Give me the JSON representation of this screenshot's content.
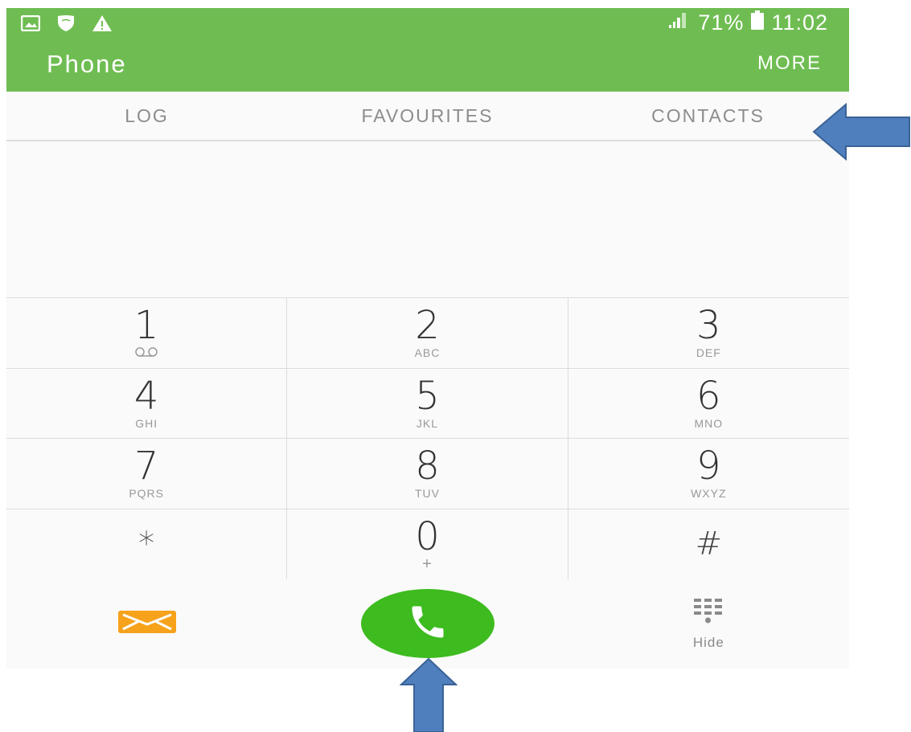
{
  "status_bar": {
    "battery": "71%",
    "time": "11:02"
  },
  "app_bar": {
    "title": "Phone",
    "more_label": "MORE"
  },
  "tabs": [
    {
      "label": "LOG"
    },
    {
      "label": "FAVOURITES"
    },
    {
      "label": "CONTACTS"
    }
  ],
  "keypad": {
    "rows": [
      [
        {
          "digit": "1",
          "letters": ""
        },
        {
          "digit": "2",
          "letters": "ABC"
        },
        {
          "digit": "3",
          "letters": "DEF"
        }
      ],
      [
        {
          "digit": "4",
          "letters": "GHI"
        },
        {
          "digit": "5",
          "letters": "JKL"
        },
        {
          "digit": "6",
          "letters": "MNO"
        }
      ],
      [
        {
          "digit": "7",
          "letters": "PQRS"
        },
        {
          "digit": "8",
          "letters": "TUV"
        },
        {
          "digit": "9",
          "letters": "WXYZ"
        }
      ],
      [
        {
          "digit": "*",
          "letters": ""
        },
        {
          "digit": "0",
          "letters": "+"
        },
        {
          "digit": "#",
          "letters": ""
        }
      ]
    ]
  },
  "actions": {
    "hide_label": "Hide"
  },
  "icons": {
    "status_left": [
      "gallery-icon",
      "shield-icon",
      "warning-icon"
    ],
    "status_right": [
      "signal-icon",
      "battery-icon"
    ],
    "voicemail": "voicemail-icon",
    "message": "message-icon",
    "call": "phone-call-icon",
    "keypad": "keypad-grid-icon",
    "annotations": [
      "arrow-left-icon",
      "arrow-up-icon"
    ]
  },
  "colors": {
    "app_bar": "#6fbd52",
    "call_button": "#3dbb1f",
    "message_icon": "#f7a21b",
    "annotation_arrow": "#4f7fbd"
  }
}
